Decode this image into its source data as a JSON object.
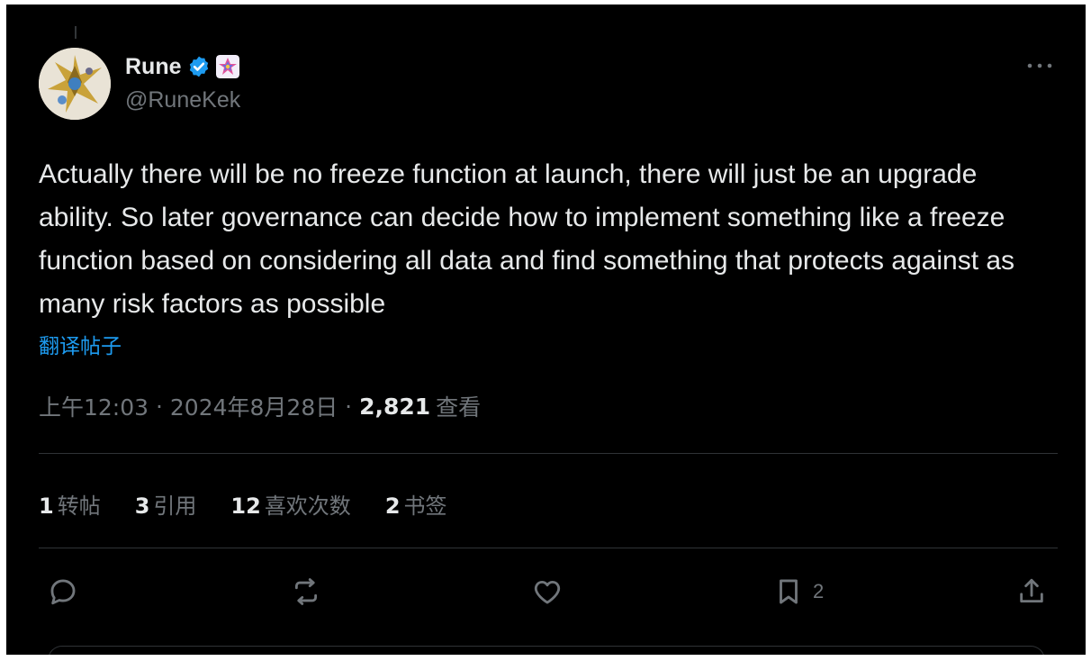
{
  "author": {
    "display_name": "Rune",
    "handle": "@RuneKek",
    "verified": true
  },
  "post": {
    "text": "Actually there will be no freeze function at launch, there will just be an upgrade ability. So later governance can decide how to implement something like a freeze function based on considering all data and find something that protects against as many risk factors as possible",
    "translate_label": "翻译帖子"
  },
  "meta": {
    "time": "上午12:03",
    "separator": " · ",
    "date": "2024年8月28日",
    "views_count": "2,821",
    "views_label": "查看"
  },
  "stats": [
    {
      "count": "1",
      "label": "转帖"
    },
    {
      "count": "3",
      "label": "引用"
    },
    {
      "count": "12",
      "label": "喜欢次数"
    },
    {
      "count": "2",
      "label": "书签"
    }
  ],
  "actions": {
    "bookmark_count": "2"
  },
  "colors": {
    "background": "#000000",
    "text_primary": "#e7e9ea",
    "text_secondary": "#71767b",
    "accent": "#1d9bf0",
    "divider": "#2f3336"
  },
  "icons": [
    "more-icon",
    "verified-badge-icon",
    "affiliate-badge-icon",
    "reply-icon",
    "repost-icon",
    "like-icon",
    "bookmark-icon",
    "share-icon"
  ]
}
